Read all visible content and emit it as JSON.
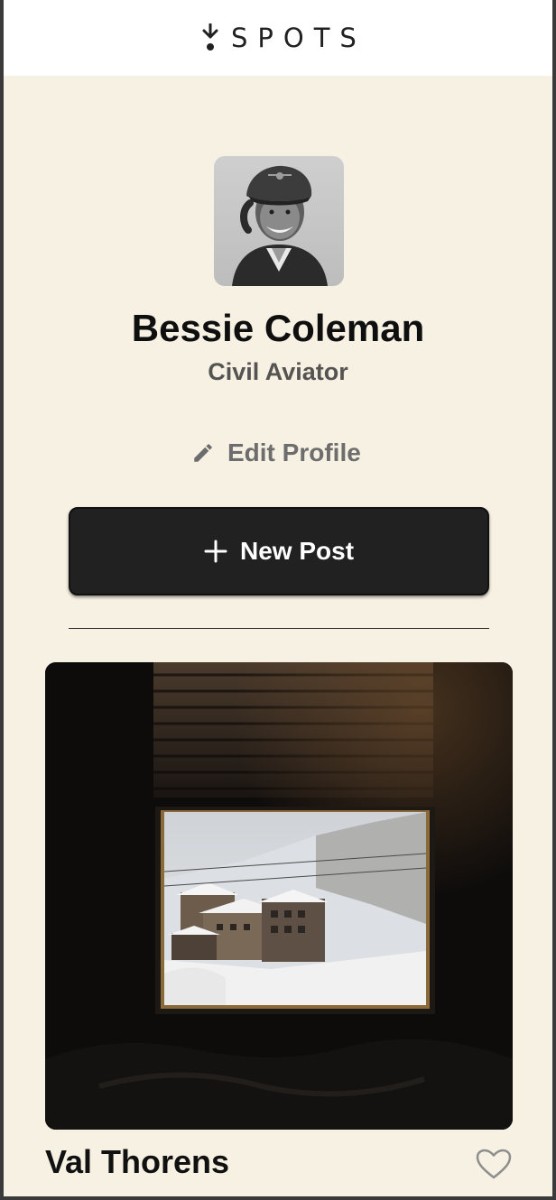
{
  "header": {
    "logo_text": "SPOTS",
    "logo_icon": "spots-logo-icon"
  },
  "profile": {
    "name": "Bessie Coleman",
    "description": "Civil Aviator",
    "edit_label": "Edit Profile",
    "edit_icon": "pencil-icon"
  },
  "actions": {
    "new_post_label": "New Post",
    "new_post_icon": "plus-icon"
  },
  "cards": [
    {
      "title": "Val Thorens",
      "liked": false,
      "like_icon": "heart-outline-icon"
    }
  ],
  "colors": {
    "page_background": "#f7f1e3",
    "header_background": "#ffffff",
    "button_background": "#212121",
    "text_primary": "#0f0f0f",
    "text_muted": "#6d6d6d"
  }
}
